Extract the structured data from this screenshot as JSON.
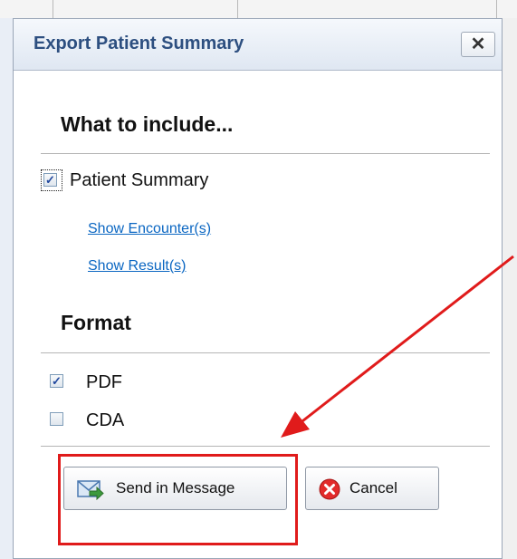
{
  "dialog": {
    "title": "Export Patient Summary",
    "close_label": "✕"
  },
  "include": {
    "heading": "What to include...",
    "patient_summary": {
      "label": "Patient Summary",
      "checked": true
    },
    "links": [
      "Show Encounter(s)",
      "Show Result(s)"
    ]
  },
  "format": {
    "heading": "Format",
    "options": [
      {
        "label": "PDF",
        "checked": true
      },
      {
        "label": "CDA",
        "checked": false
      }
    ]
  },
  "buttons": {
    "send": "Send in Message",
    "cancel": "Cancel"
  },
  "colors": {
    "annotation": "#e01b1b",
    "link": "#0a66c2",
    "title": "#2d4f80"
  },
  "icons": {
    "send": "envelope-arrow-icon",
    "cancel": "red-x-circle-icon"
  }
}
